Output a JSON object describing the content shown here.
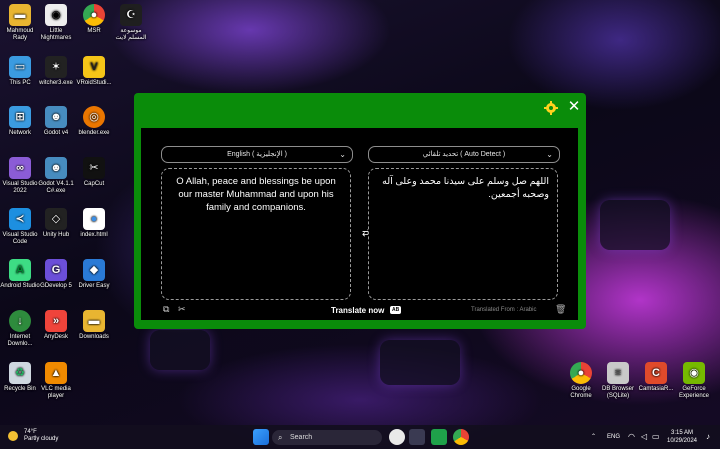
{
  "desktop_icons": [
    {
      "label": "Mahmoud Rady",
      "icon": "folder-icon",
      "color": "#e8b531"
    },
    {
      "label": "Little Nightmares",
      "icon": "eye-icon",
      "color": "#eeeeee"
    },
    {
      "label": "MSR",
      "icon": "chrome-icon",
      "color": "#3a8ee6"
    },
    {
      "label": "موسوعة المسلم لايت",
      "icon": "crescent-icon",
      "color": "#1f1f1f"
    },
    {
      "label": "This PC",
      "icon": "monitor-icon",
      "color": "#3b9be0"
    },
    {
      "label": "witcher3.exe",
      "icon": "star-icon",
      "color": "#222222"
    },
    {
      "label": "VRoidStudi...",
      "icon": "vroid-icon",
      "color": "#f5c518"
    },
    {
      "label": "Network",
      "icon": "network-icon",
      "color": "#3b9be0"
    },
    {
      "label": "Godot v4",
      "icon": "godot-icon",
      "color": "#478cbf"
    },
    {
      "label": "blender.exe",
      "icon": "blender-icon",
      "color": "#ea7600"
    },
    {
      "label": "Visual Studio 2022",
      "icon": "vs-icon",
      "color": "#8b5cd6"
    },
    {
      "label": "Godot V4.1.1 C#.exe",
      "icon": "godot-icon",
      "color": "#478cbf"
    },
    {
      "label": "CapCut",
      "icon": "capcut-icon",
      "color": "#111111"
    },
    {
      "label": "Visual Studio Code",
      "icon": "vscode-icon",
      "color": "#1d8fe0"
    },
    {
      "label": "Unity Hub",
      "icon": "unity-icon",
      "color": "#222222"
    },
    {
      "label": "index.html",
      "icon": "chrome-icon",
      "color": "#ffffff"
    },
    {
      "label": "Android Studio",
      "icon": "android-icon",
      "color": "#3ddc84"
    },
    {
      "label": "GDevelop 5",
      "icon": "gdevelop-icon",
      "color": "#6b4fd8"
    },
    {
      "label": "Driver Easy",
      "icon": "drivereasy-icon",
      "color": "#2a7ad6"
    },
    {
      "label": "Internet Downlo...",
      "icon": "idm-icon",
      "color": "#2e8b3d"
    },
    {
      "label": "AnyDesk",
      "icon": "anydesk-icon",
      "color": "#ef443b"
    },
    {
      "label": "Downloads",
      "icon": "folder-icon",
      "color": "#e8b531"
    },
    {
      "label": "Recycle Bin",
      "icon": "recycle-icon",
      "color": "#cfd8e0"
    },
    {
      "label": "VLC media player",
      "icon": "vlc-icon",
      "color": "#f08a00"
    },
    {
      "label": "Google Chrome",
      "icon": "chrome-icon",
      "color": "#3a8ee6"
    },
    {
      "label": "DB Browser (SQLite)",
      "icon": "database-icon",
      "color": "#c9c9c9"
    },
    {
      "label": "CamtasiaR...",
      "icon": "camtasia-icon",
      "color": "#e04a2b"
    },
    {
      "label": "GeForce Experience",
      "icon": "nvidia-icon",
      "color": "#76b900"
    }
  ],
  "translator": {
    "close_symbol": "✕",
    "source_lang": "English ( الإنجليزية )",
    "target_lang": "تحديد تلقائي ( Auto Detect )",
    "source_text": "O Allah, peace and blessings be upon our master Muhammad and upon his family and companions.",
    "target_text": "اللهم صل وسلم على سيدنا محمد وعلى آله وصحبه أجمعين.",
    "translate_button": "Translate now",
    "translate_badge": "AB",
    "translated_from": "Translated From : Arabic",
    "accent_color": "#0a8c0a"
  },
  "taskbar": {
    "weather_temp": "74°F",
    "weather_desc": "Partly cloudy",
    "search_placeholder": "Search",
    "language": "ENG",
    "time": "3:15 AM",
    "date": "10/29/2024"
  }
}
